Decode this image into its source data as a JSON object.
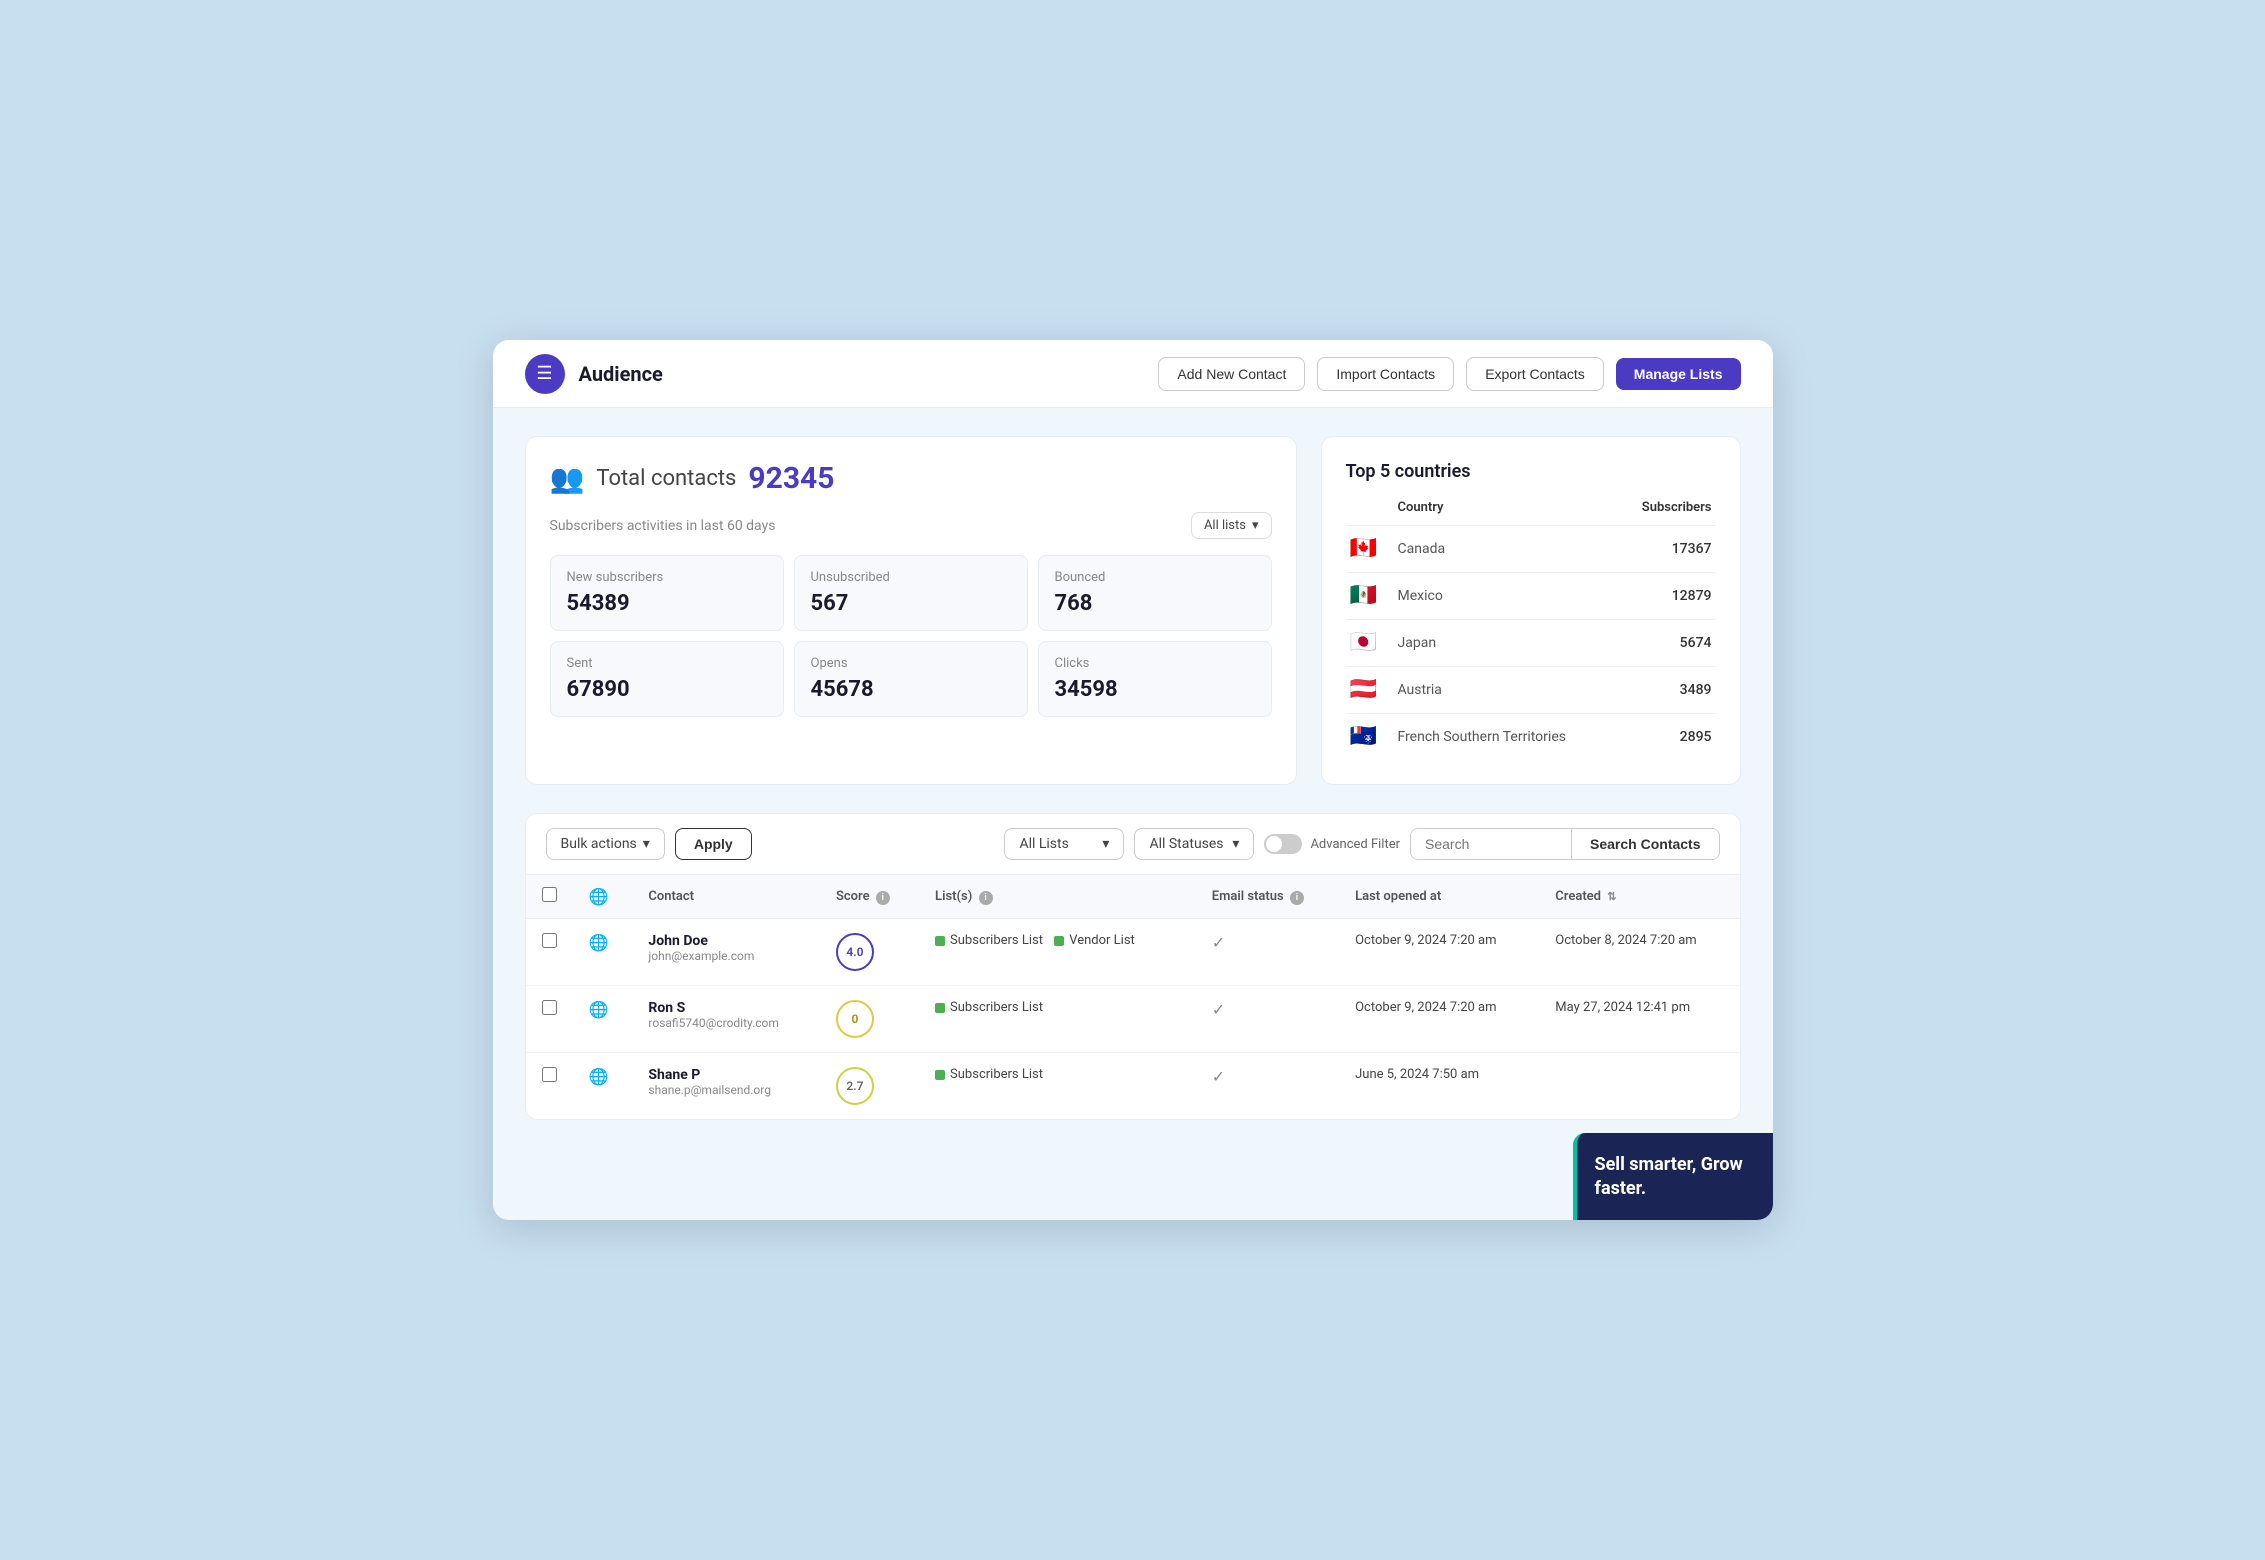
{
  "header": {
    "logo_symbol": "☰",
    "title": "Audience",
    "buttons": {
      "add_contact": "Add New Contact",
      "import_contacts": "Import Contacts",
      "export_contacts": "Export Contacts",
      "manage_lists": "Manage Lists"
    }
  },
  "stats": {
    "total_label": "Total contacts",
    "total_number": "92345",
    "activities_subtitle": "Subscribers activities in last 60 days",
    "all_lists_label": "All lists",
    "cards": [
      {
        "label": "New subscribers",
        "value": "54389"
      },
      {
        "label": "Unsubscribed",
        "value": "567"
      },
      {
        "label": "Bounced",
        "value": "768"
      },
      {
        "label": "Sent",
        "value": "67890"
      },
      {
        "label": "Opens",
        "value": "45678"
      },
      {
        "label": "Clicks",
        "value": "34598"
      }
    ]
  },
  "countries": {
    "title": "Top 5 countries",
    "col_country": "Country",
    "col_subscribers": "Subscribers",
    "rows": [
      {
        "flag": "🇨🇦",
        "name": "Canada",
        "count": "17367"
      },
      {
        "flag": "🇲🇽",
        "name": "Mexico",
        "count": "12879"
      },
      {
        "flag": "🇯🇵",
        "name": "Japan",
        "count": "5674"
      },
      {
        "flag": "🇦🇹",
        "name": "Austria",
        "count": "3489"
      },
      {
        "flag": "🇹🇫",
        "name": "French Southern Territories",
        "count": "2895"
      }
    ]
  },
  "toolbar": {
    "bulk_actions": "Bulk actions",
    "apply": "Apply",
    "all_lists": "All Lists",
    "all_statuses": "All Statuses",
    "advanced_filter": "Advanced Filter",
    "search_placeholder": "Search",
    "search_contacts_btn": "Search Contacts"
  },
  "table": {
    "cols": {
      "contact": "Contact",
      "score": "Score",
      "lists": "List(s)",
      "email_status": "Email status",
      "last_opened": "Last opened at",
      "created": "Created"
    },
    "rows": [
      {
        "name": "John Doe",
        "email": "john@example.com",
        "score": "4.0",
        "score_class": "score-4",
        "lists": [
          "Subscribers List",
          "Vendor List"
        ],
        "email_status": "✓",
        "last_opened": "October 9, 2024 7:20 am",
        "created": "October 8, 2024 7:20 am"
      },
      {
        "name": "Ron S",
        "email": "rosafi5740@crodity.com",
        "score": "0",
        "score_class": "score-0",
        "lists": [
          "Subscribers List"
        ],
        "email_status": "✓",
        "last_opened": "October 9, 2024 7:20 am",
        "created": "May 27, 2024 12:41 pm"
      },
      {
        "name": "Shane P",
        "email": "shane.p@mailsend.org",
        "score": "2.7",
        "score_class": "score-2-7",
        "lists": [
          "Subscribers List"
        ],
        "email_status": "✓",
        "last_opened": "June 5, 2024 7:50 am",
        "created": ""
      }
    ]
  },
  "promo": {
    "text": "Sell smarter, Grow faster."
  }
}
